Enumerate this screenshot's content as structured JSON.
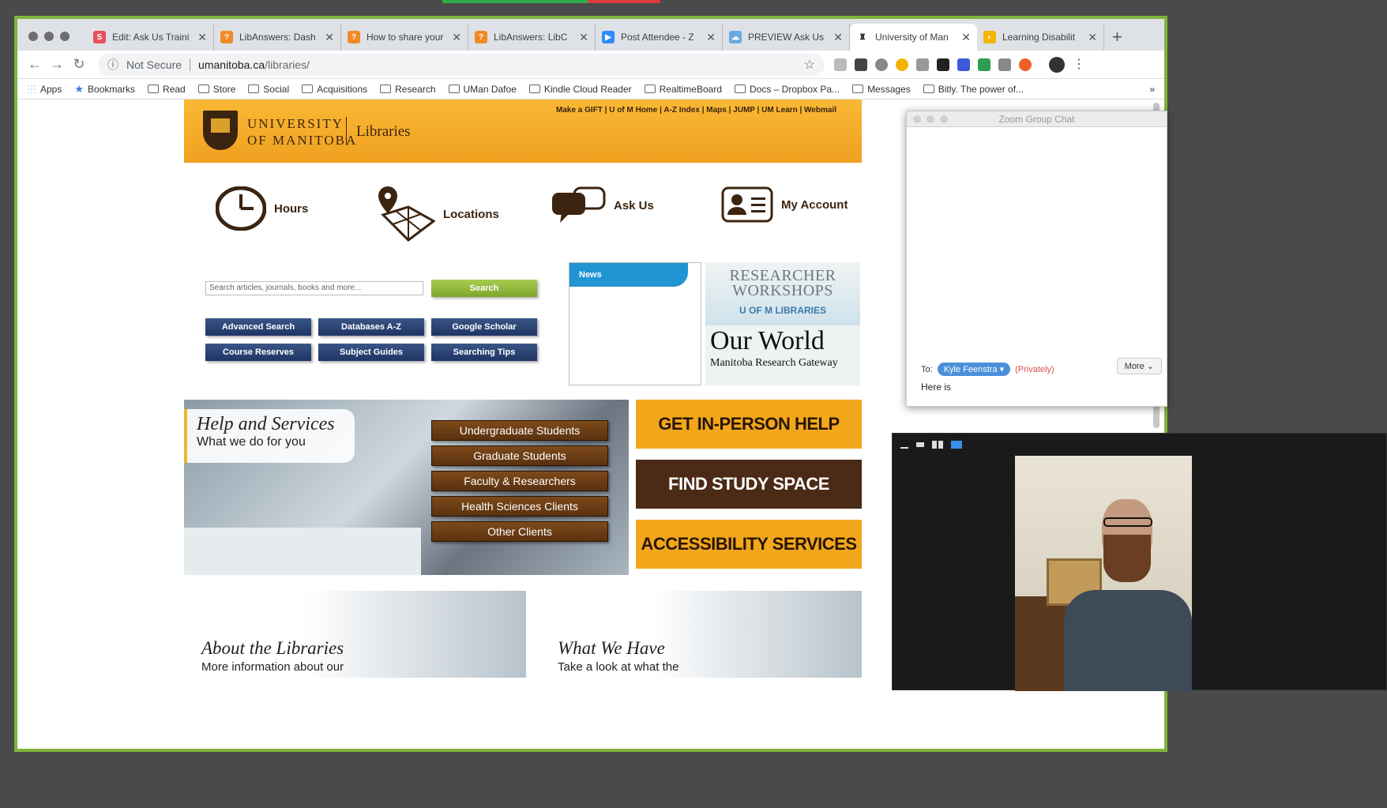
{
  "browser": {
    "tabs": [
      {
        "label": "Edit: Ask Us Traini",
        "fav_color": "#e8505b",
        "fav_glyph": "S"
      },
      {
        "label": "LibAnswers: Dash",
        "fav_color": "#f08a24",
        "fav_glyph": "?"
      },
      {
        "label": "How to share your",
        "fav_color": "#f08a24",
        "fav_glyph": "?"
      },
      {
        "label": "LibAnswers: LibC",
        "fav_color": "#f08a24",
        "fav_glyph": "?"
      },
      {
        "label": "Post Attendee - Z",
        "fav_color": "#2d8cff",
        "fav_glyph": "▶"
      },
      {
        "label": "PREVIEW Ask Us",
        "fav_color": "#6aa9e0",
        "fav_glyph": "☁"
      },
      {
        "label": "University of Man",
        "fav_color": "#ffffff",
        "fav_glyph": "♜"
      },
      {
        "label": "Learning Disabilit",
        "fav_color": "#f4b400",
        "fav_glyph": "◐"
      }
    ],
    "active_tab": 6,
    "address": {
      "security": "Not Secure",
      "host": "umanitoba.ca",
      "path": "/libraries/"
    },
    "bookmarks": [
      "Apps",
      "Bookmarks",
      "Read",
      "Store",
      "Social",
      "Acquisitions",
      "Research",
      "UMan Dafoe",
      "Kindle Cloud Reader",
      "RealtimeBoard",
      "Docs – Dropbox Pa...",
      "Messages",
      "Bitly. The power of..."
    ],
    "bookmarks_overflow": "»"
  },
  "site": {
    "university_line1": "UNIVERSITY",
    "university_line2": "OF MANITOBA",
    "libraries": "Libraries",
    "top_links": "Make a GIFT | U of M Home | A-Z Index | Maps | JUMP | UM Learn | Webmail",
    "quick_links": [
      "Hours",
      "Locations",
      "Ask Us",
      "My Account"
    ],
    "search_placeholder": "Search articles, journals, books and more...",
    "search_button": "Search",
    "search_links": [
      "Advanced Search",
      "Databases A-Z",
      "Google Scholar",
      "Course Reserves",
      "Subject Guides",
      "Searching Tips"
    ],
    "news_label": "News",
    "rw_title1": "RESEARCHER",
    "rw_title2": "WORKSHOPS",
    "rw_sub": "U OF M LIBRARIES",
    "our_world": "Our World",
    "mrg": "Manitoba Research Gateway",
    "help_title": "Help and Services",
    "help_sub": "What we do for you",
    "client_buttons": [
      "Undergraduate Students",
      "Graduate Students",
      "Faculty & Researchers",
      "Health Sciences Clients",
      "Other Clients"
    ],
    "big_buttons": [
      "GET IN-PERSON HELP",
      "FIND STUDY SPACE",
      "ACCESSIBILITY SERVICES"
    ],
    "promo_about_title": "About the Libraries",
    "promo_about_sub": "More information about our",
    "promo_have_title": "What We Have",
    "promo_have_sub": "Take a look at what the"
  },
  "zoom_chat": {
    "title": "Zoom Group Chat",
    "to_label": "To:",
    "recipient": "Kyle Feenstra",
    "privacy": "(Privately)",
    "more": "More",
    "message": "Here is"
  },
  "colors": {
    "accent_gold": "#f2a71b",
    "brand_brown": "#4b2a16",
    "navy_button": "#1e3464",
    "search_green": "#7da62a",
    "window_border": "#7fb33c"
  }
}
